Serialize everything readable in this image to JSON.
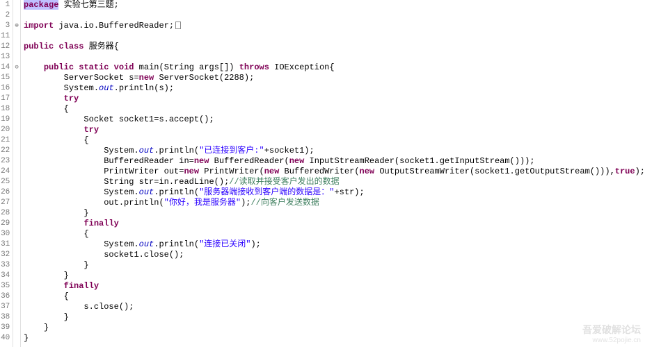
{
  "lines": [
    {
      "n": "1",
      "mk": "",
      "html": "<span class='sel'><span class='kw'>package</span></span> 实验七第三题;"
    },
    {
      "n": "2",
      "mk": "",
      "html": ""
    },
    {
      "n": "3",
      "mk": "⊕",
      "html": "<span class='kw'>import</span> java.io.BufferedReader;<span class='box'></span>"
    },
    {
      "n": "11",
      "mk": "",
      "html": ""
    },
    {
      "n": "12",
      "mk": "",
      "html": "<span class='kw'>public</span> <span class='kw'>class</span> 服务器{"
    },
    {
      "n": "13",
      "mk": "",
      "html": ""
    },
    {
      "n": "14",
      "mk": "⊖",
      "html": "    <span class='kw'>public</span> <span class='kw'>static</span> <span class='kw'>void</span> main(String args[]) <span class='kw'>throws</span> IOException{"
    },
    {
      "n": "15",
      "mk": "",
      "html": "        ServerSocket s=<span class='kw'>new</span> ServerSocket(2288);"
    },
    {
      "n": "16",
      "mk": "",
      "html": "        System.<span class='static-it'>out</span>.println(s);"
    },
    {
      "n": "17",
      "mk": "",
      "html": "        <span class='kw'>try</span>"
    },
    {
      "n": "18",
      "mk": "",
      "html": "        {"
    },
    {
      "n": "19",
      "mk": "",
      "html": "            Socket socket1=s.accept();"
    },
    {
      "n": "20",
      "mk": "",
      "html": "            <span class='kw'>try</span>"
    },
    {
      "n": "21",
      "mk": "",
      "html": "            {"
    },
    {
      "n": "22",
      "mk": "",
      "html": "                System.<span class='static-it'>out</span>.println(<span class='str'>\"已连接到客户:\"</span>+socket1);"
    },
    {
      "n": "23",
      "mk": "",
      "html": "                BufferedReader in=<span class='kw'>new</span> BufferedReader(<span class='kw'>new</span> InputStreamReader(socket1.getInputStream()));"
    },
    {
      "n": "24",
      "mk": "",
      "html": "                PrintWriter out=<span class='kw'>new</span> PrintWriter(<span class='kw'>new</span> BufferedWriter(<span class='kw'>new</span> OutputStreamWriter(socket1.getOutputStream())),<span class='kw'>true</span>);"
    },
    {
      "n": "25",
      "mk": "",
      "html": "                String str=in.readLine();<span class='com'>//读取并接受客户发出的数据</span>"
    },
    {
      "n": "26",
      "mk": "",
      "html": "                System.<span class='static-it'>out</span>.println(<span class='str'>\"服务器端接收到客户端的数据是：\"</span>+str);"
    },
    {
      "n": "27",
      "mk": "",
      "html": "                out.println(<span class='str'>\"你好，我是服务器\"</span>);<span class='com'>//向客户发送数据</span>"
    },
    {
      "n": "28",
      "mk": "",
      "html": "            }"
    },
    {
      "n": "29",
      "mk": "",
      "html": "            <span class='kw'>finally</span>"
    },
    {
      "n": "30",
      "mk": "",
      "html": "            {"
    },
    {
      "n": "31",
      "mk": "",
      "html": "                System.<span class='static-it'>out</span>.println(<span class='str'>\"连接已关闭\"</span>);"
    },
    {
      "n": "32",
      "mk": "",
      "html": "                socket1.close();"
    },
    {
      "n": "33",
      "mk": "",
      "html": "            }"
    },
    {
      "n": "34",
      "mk": "",
      "html": "        }"
    },
    {
      "n": "35",
      "mk": "",
      "html": "        <span class='kw'>finally</span>"
    },
    {
      "n": "36",
      "mk": "",
      "html": "        {"
    },
    {
      "n": "37",
      "mk": "",
      "html": "            s.close();"
    },
    {
      "n": "38",
      "mk": "",
      "html": "        }"
    },
    {
      "n": "39",
      "mk": "",
      "html": "    }"
    },
    {
      "n": "40",
      "mk": "",
      "html": "}"
    }
  ],
  "watermark": {
    "line1": "吾爱破解论坛",
    "line2": "www.52pojie.cn"
  }
}
